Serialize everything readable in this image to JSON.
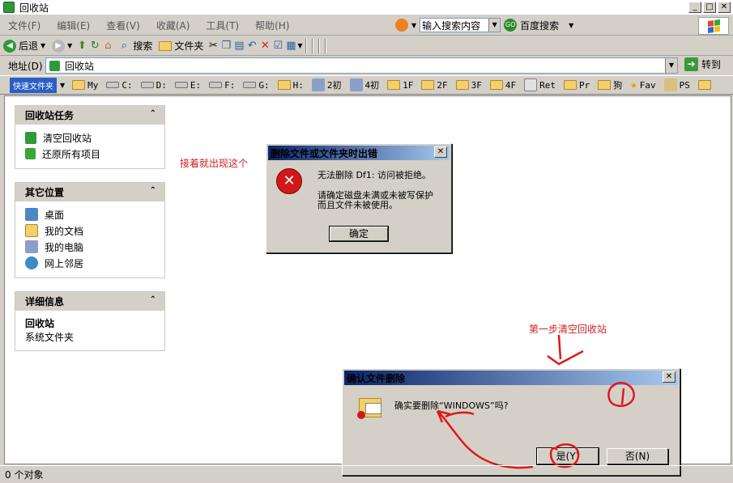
{
  "window": {
    "title": "回收站"
  },
  "menu": [
    "文件(F)",
    "编辑(E)",
    "查看(V)",
    "收藏(A)",
    "工具(T)",
    "帮助(H)"
  ],
  "search": {
    "value": "输入搜索内容",
    "button": "百度搜索"
  },
  "toolbar": {
    "back": "后退",
    "search": "搜索",
    "folders": "文件夹"
  },
  "address": {
    "label": "地址(D)",
    "value": "回收站",
    "go": "转到"
  },
  "links": {
    "quick": "快速文件夹",
    "items": [
      "My",
      "C:",
      "D:",
      "E:",
      "F:",
      "G:",
      "H:",
      "2初",
      "4初",
      "1F",
      "2F",
      "3F",
      "4F",
      "Ret",
      "Pr",
      "狗",
      "Fav",
      "PS"
    ]
  },
  "panels": {
    "tasks": {
      "title": "回收站任务",
      "items": [
        "清空回收站",
        "还原所有项目"
      ]
    },
    "places": {
      "title": "其它位置",
      "items": [
        "桌面",
        "我的文档",
        "我的电脑",
        "网上邻居"
      ]
    },
    "details": {
      "title": "详细信息",
      "name": "回收站",
      "type": "系统文件夹"
    }
  },
  "annotations": {
    "error_note": "接着就出现这个",
    "step_note": "第一步清空回收站"
  },
  "error_dialog": {
    "title": "删除文件或文件夹时出错",
    "line1": "无法删除 Df1: 访问被拒绝。",
    "line2": "请确定磁盘未满或未被写保护",
    "line3": "而且文件未被使用。",
    "ok": "确定"
  },
  "confirm_dialog": {
    "title": "确认文件删除",
    "message": "确实要删除“WINDOWS”吗?",
    "yes": "是(Y)",
    "no": "否(N)"
  },
  "status": "0 个对象",
  "colors": {
    "annotation": "#d02020",
    "title_gradient_start": "#0a246a",
    "title_gradient_end": "#a6caf0"
  }
}
